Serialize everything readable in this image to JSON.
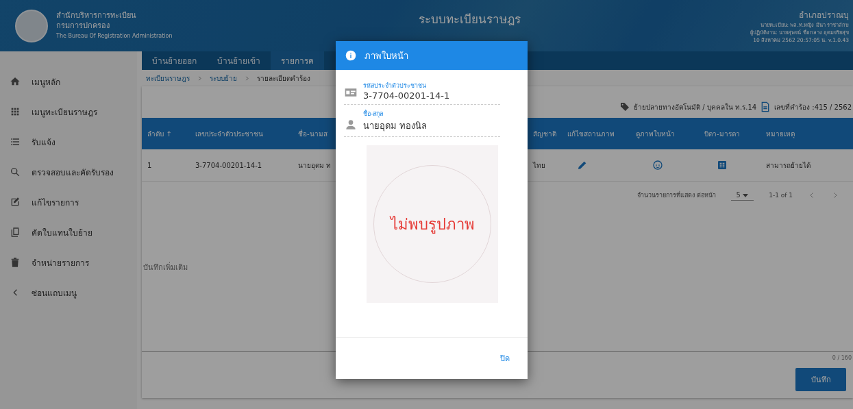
{
  "header": {
    "org_lines": [
      "สำนักบริหารการทะเบียน",
      "กรมการปกครอง",
      "The Bureau Of Registration Administration"
    ],
    "title": "ระบบทะเบียนราษฎร",
    "office": "อำเภอปราณบุ",
    "info_lines": [
      "นายทะเบียน: พล.ท.หญิง มีนา ราชาลักษ",
      "ผู้ปฏิบัติงาน: นายสุพจน์ ชื่อกลาง อุดมจริยสุข",
      "10 สิงหาคม 2562 20:57:05 น.  v.1.0.43"
    ]
  },
  "sidebar": {
    "items": [
      {
        "label": "เมนูหลัก"
      },
      {
        "label": "เมนูทะเบียนราษฎร"
      },
      {
        "label": "รับแจ้ง"
      },
      {
        "label": "ตรวจสอบและคัดรับรอง"
      },
      {
        "label": "แก้ไขรายการ"
      },
      {
        "label": "คัดใบแทนใบย้าย"
      },
      {
        "label": "จำหน่ายรายการ"
      },
      {
        "label": "ซ่อนแถบเมนู"
      }
    ]
  },
  "tabs": [
    {
      "label": "บ้านย้ายออก",
      "selected": false
    },
    {
      "label": "บ้านย้ายเข้า",
      "selected": false
    },
    {
      "label": "รายการค",
      "selected": true
    }
  ],
  "breadcrumb": [
    "ทะเบียนราษฎร",
    "ระบบย้าย",
    "รายละเอียดคำร้อง"
  ],
  "request_info": {
    "type": "ย้ายปลายทางอัตโนมัติ / บุคคลใน ท.ร.14",
    "number": "เลขที่คำร้อง :415 / 2562"
  },
  "table": {
    "columns": [
      {
        "label": "ลำดับ ↑"
      },
      {
        "label": "เลขประจำตัวประชาชน"
      },
      {
        "label": "ชื่อ-นามส"
      },
      {
        "label": "สัญชาติ"
      },
      {
        "label": "แก้ไขสถานภาพ"
      },
      {
        "label": "ดูภาพใบหน้า"
      },
      {
        "label": "บิดา-มารดา"
      },
      {
        "label": "หมายเหตุ"
      }
    ],
    "rows": [
      {
        "cells": [
          {
            "kind": "text",
            "text": "1"
          },
          {
            "kind": "text",
            "text": "3-7704-00201-14-1"
          },
          {
            "kind": "text",
            "text": "นายอุดม ท"
          },
          {
            "kind": "text",
            "text": "ไทย"
          },
          {
            "kind": "edit"
          },
          {
            "kind": "face"
          },
          {
            "kind": "book"
          },
          {
            "kind": "text",
            "text": "สามารถย้ายได้"
          }
        ]
      }
    ]
  },
  "pagination": {
    "label": "จำนวนรายการที่แสดง ต่อหน้า",
    "per_page": "5",
    "range": "1-1 of 1"
  },
  "notes": {
    "placeholder": "บันทึกเพิ่มเติม",
    "counter": "0 / 160"
  },
  "save_button": "บันทึก",
  "modal": {
    "title": "ภาพใบหน้า",
    "fields": [
      {
        "label": "รหัสประจำตัวประชาชน",
        "value": "3-7704-00201-14-1"
      },
      {
        "label": "ชื่อ-สกุล",
        "value": "นายอุดม ทองนิล"
      }
    ],
    "photo_text": "ไม่พบรูปภาพ",
    "close_button": "ปิด"
  }
}
